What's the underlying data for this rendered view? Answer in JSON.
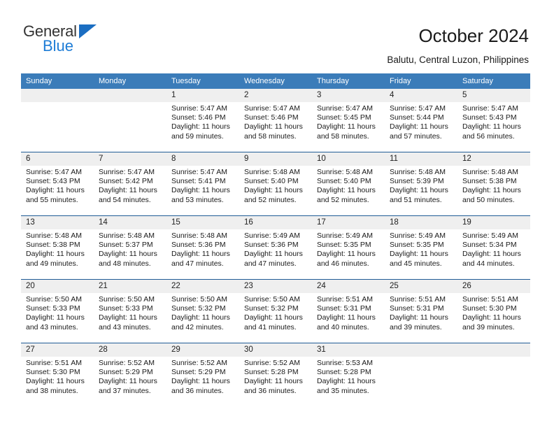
{
  "brand": {
    "name_top": "General",
    "name_bottom": "Blue",
    "triangle_color": "#1b6ec2",
    "blue_text_color": "#1d7cd6"
  },
  "header": {
    "title": "October 2024",
    "subtitle": "Balutu, Central Luzon, Philippines"
  },
  "theme": {
    "header_row_bg": "#3b7cb9",
    "row_divider": "#205c96",
    "daynum_bg": "#efefef"
  },
  "calendar": {
    "weekday_headers": [
      "Sunday",
      "Monday",
      "Tuesday",
      "Wednesday",
      "Thursday",
      "Friday",
      "Saturday"
    ],
    "weeks": [
      [
        {
          "day": "",
          "sunrise": "",
          "sunset": "",
          "daylight": "",
          "empty": true
        },
        {
          "day": "",
          "sunrise": "",
          "sunset": "",
          "daylight": "",
          "empty": true
        },
        {
          "day": "1",
          "sunrise": "Sunrise: 5:47 AM",
          "sunset": "Sunset: 5:46 PM",
          "daylight": "Daylight: 11 hours and 59 minutes."
        },
        {
          "day": "2",
          "sunrise": "Sunrise: 5:47 AM",
          "sunset": "Sunset: 5:46 PM",
          "daylight": "Daylight: 11 hours and 58 minutes."
        },
        {
          "day": "3",
          "sunrise": "Sunrise: 5:47 AM",
          "sunset": "Sunset: 5:45 PM",
          "daylight": "Daylight: 11 hours and 58 minutes."
        },
        {
          "day": "4",
          "sunrise": "Sunrise: 5:47 AM",
          "sunset": "Sunset: 5:44 PM",
          "daylight": "Daylight: 11 hours and 57 minutes."
        },
        {
          "day": "5",
          "sunrise": "Sunrise: 5:47 AM",
          "sunset": "Sunset: 5:43 PM",
          "daylight": "Daylight: 11 hours and 56 minutes."
        }
      ],
      [
        {
          "day": "6",
          "sunrise": "Sunrise: 5:47 AM",
          "sunset": "Sunset: 5:43 PM",
          "daylight": "Daylight: 11 hours and 55 minutes."
        },
        {
          "day": "7",
          "sunrise": "Sunrise: 5:47 AM",
          "sunset": "Sunset: 5:42 PM",
          "daylight": "Daylight: 11 hours and 54 minutes."
        },
        {
          "day": "8",
          "sunrise": "Sunrise: 5:47 AM",
          "sunset": "Sunset: 5:41 PM",
          "daylight": "Daylight: 11 hours and 53 minutes."
        },
        {
          "day": "9",
          "sunrise": "Sunrise: 5:48 AM",
          "sunset": "Sunset: 5:40 PM",
          "daylight": "Daylight: 11 hours and 52 minutes."
        },
        {
          "day": "10",
          "sunrise": "Sunrise: 5:48 AM",
          "sunset": "Sunset: 5:40 PM",
          "daylight": "Daylight: 11 hours and 52 minutes."
        },
        {
          "day": "11",
          "sunrise": "Sunrise: 5:48 AM",
          "sunset": "Sunset: 5:39 PM",
          "daylight": "Daylight: 11 hours and 51 minutes."
        },
        {
          "day": "12",
          "sunrise": "Sunrise: 5:48 AM",
          "sunset": "Sunset: 5:38 PM",
          "daylight": "Daylight: 11 hours and 50 minutes."
        }
      ],
      [
        {
          "day": "13",
          "sunrise": "Sunrise: 5:48 AM",
          "sunset": "Sunset: 5:38 PM",
          "daylight": "Daylight: 11 hours and 49 minutes."
        },
        {
          "day": "14",
          "sunrise": "Sunrise: 5:48 AM",
          "sunset": "Sunset: 5:37 PM",
          "daylight": "Daylight: 11 hours and 48 minutes."
        },
        {
          "day": "15",
          "sunrise": "Sunrise: 5:48 AM",
          "sunset": "Sunset: 5:36 PM",
          "daylight": "Daylight: 11 hours and 47 minutes."
        },
        {
          "day": "16",
          "sunrise": "Sunrise: 5:49 AM",
          "sunset": "Sunset: 5:36 PM",
          "daylight": "Daylight: 11 hours and 47 minutes."
        },
        {
          "day": "17",
          "sunrise": "Sunrise: 5:49 AM",
          "sunset": "Sunset: 5:35 PM",
          "daylight": "Daylight: 11 hours and 46 minutes."
        },
        {
          "day": "18",
          "sunrise": "Sunrise: 5:49 AM",
          "sunset": "Sunset: 5:35 PM",
          "daylight": "Daylight: 11 hours and 45 minutes."
        },
        {
          "day": "19",
          "sunrise": "Sunrise: 5:49 AM",
          "sunset": "Sunset: 5:34 PM",
          "daylight": "Daylight: 11 hours and 44 minutes."
        }
      ],
      [
        {
          "day": "20",
          "sunrise": "Sunrise: 5:50 AM",
          "sunset": "Sunset: 5:33 PM",
          "daylight": "Daylight: 11 hours and 43 minutes."
        },
        {
          "day": "21",
          "sunrise": "Sunrise: 5:50 AM",
          "sunset": "Sunset: 5:33 PM",
          "daylight": "Daylight: 11 hours and 43 minutes."
        },
        {
          "day": "22",
          "sunrise": "Sunrise: 5:50 AM",
          "sunset": "Sunset: 5:32 PM",
          "daylight": "Daylight: 11 hours and 42 minutes."
        },
        {
          "day": "23",
          "sunrise": "Sunrise: 5:50 AM",
          "sunset": "Sunset: 5:32 PM",
          "daylight": "Daylight: 11 hours and 41 minutes."
        },
        {
          "day": "24",
          "sunrise": "Sunrise: 5:51 AM",
          "sunset": "Sunset: 5:31 PM",
          "daylight": "Daylight: 11 hours and 40 minutes."
        },
        {
          "day": "25",
          "sunrise": "Sunrise: 5:51 AM",
          "sunset": "Sunset: 5:31 PM",
          "daylight": "Daylight: 11 hours and 39 minutes."
        },
        {
          "day": "26",
          "sunrise": "Sunrise: 5:51 AM",
          "sunset": "Sunset: 5:30 PM",
          "daylight": "Daylight: 11 hours and 39 minutes."
        }
      ],
      [
        {
          "day": "27",
          "sunrise": "Sunrise: 5:51 AM",
          "sunset": "Sunset: 5:30 PM",
          "daylight": "Daylight: 11 hours and 38 minutes."
        },
        {
          "day": "28",
          "sunrise": "Sunrise: 5:52 AM",
          "sunset": "Sunset: 5:29 PM",
          "daylight": "Daylight: 11 hours and 37 minutes."
        },
        {
          "day": "29",
          "sunrise": "Sunrise: 5:52 AM",
          "sunset": "Sunset: 5:29 PM",
          "daylight": "Daylight: 11 hours and 36 minutes."
        },
        {
          "day": "30",
          "sunrise": "Sunrise: 5:52 AM",
          "sunset": "Sunset: 5:28 PM",
          "daylight": "Daylight: 11 hours and 36 minutes."
        },
        {
          "day": "31",
          "sunrise": "Sunrise: 5:53 AM",
          "sunset": "Sunset: 5:28 PM",
          "daylight": "Daylight: 11 hours and 35 minutes."
        },
        {
          "day": "",
          "sunrise": "",
          "sunset": "",
          "daylight": "",
          "empty": true
        },
        {
          "day": "",
          "sunrise": "",
          "sunset": "",
          "daylight": "",
          "empty": true
        }
      ]
    ]
  }
}
